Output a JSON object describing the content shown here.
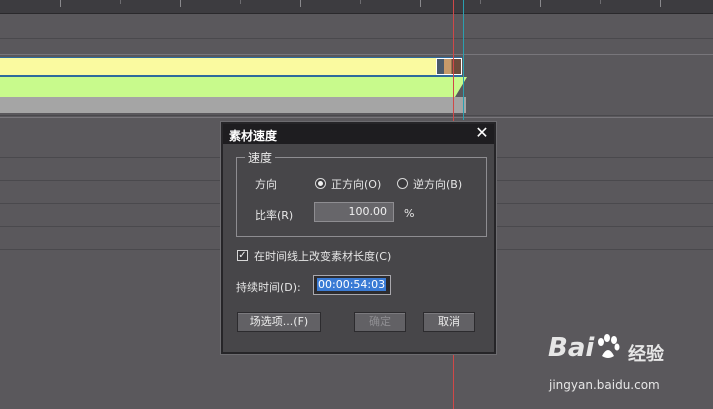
{
  "dialog": {
    "title": "素材速度",
    "group_label": "速度",
    "direction_label": "方向",
    "forward_label": "正方向(O)",
    "reverse_label": "逆方向(B)",
    "ratio_label": "比率(R)",
    "ratio_value": "100.00",
    "ratio_unit": "%",
    "change_length_label": "在时间线上改变素材长度(C)",
    "change_length_checked": true,
    "duration_label": "持续时间(D):",
    "duration_value": "00:00:54:03",
    "field_options_button": "场选项...(F)",
    "ok_button": "确定",
    "cancel_button": "取消"
  },
  "selected_direction": "forward",
  "watermark": {
    "logo": "Bai  ",
    "cn": "经验",
    "url": "jingyan.baidu.com"
  },
  "colors": {
    "track_bg": "#5a585c",
    "clip_video": "#fafaa0",
    "clip_audio": "#c8fa8c",
    "dialog_bg": "#474649",
    "title_bg": "#1e1d20",
    "selection": "#3a7bd5"
  }
}
